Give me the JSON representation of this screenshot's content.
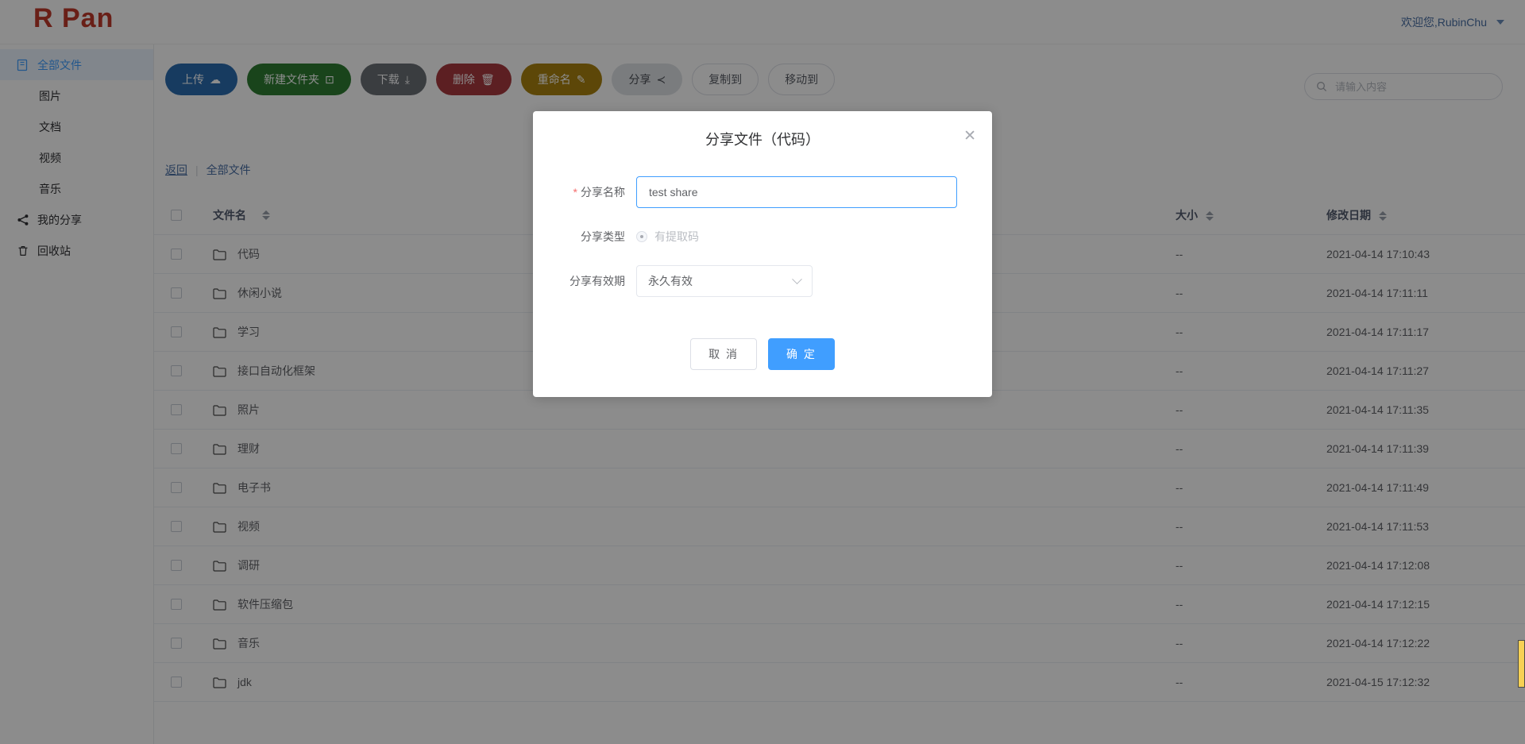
{
  "app": {
    "logo": "R Pan",
    "user_greeting": "欢迎您,RubinChu"
  },
  "sidebar": {
    "items": [
      {
        "label": "全部文件",
        "icon": "files-icon",
        "active": true,
        "indent": false
      },
      {
        "label": "图片",
        "icon": "",
        "active": false,
        "indent": true
      },
      {
        "label": "文档",
        "icon": "",
        "active": false,
        "indent": true
      },
      {
        "label": "视频",
        "icon": "",
        "active": false,
        "indent": true
      },
      {
        "label": "音乐",
        "icon": "",
        "active": false,
        "indent": true
      },
      {
        "label": "我的分享",
        "icon": "share-icon",
        "active": false,
        "indent": false
      },
      {
        "label": "回收站",
        "icon": "trash-icon",
        "active": false,
        "indent": false
      }
    ]
  },
  "toolbar": {
    "buttons": [
      {
        "label": "上传",
        "glyph": "☁",
        "style": "primary"
      },
      {
        "label": "新建文件夹",
        "glyph": "⊡",
        "style": "success"
      },
      {
        "label": "下载",
        "glyph": "⤓",
        "style": "info"
      },
      {
        "label": "删除",
        "glyph": "🗑",
        "style": "danger"
      },
      {
        "label": "重命名",
        "glyph": "✎",
        "style": "warning"
      },
      {
        "label": "分享",
        "glyph": "≺",
        "style": "plain-a"
      },
      {
        "label": "复制到",
        "glyph": "",
        "style": "plain"
      },
      {
        "label": "移动到",
        "glyph": "",
        "style": "plain"
      }
    ]
  },
  "search": {
    "placeholder": "请输入内容",
    "value": ""
  },
  "breadcrumb": {
    "back_label": "返回",
    "separator": "|",
    "current": "全部文件"
  },
  "table": {
    "headers": {
      "name": "文件名",
      "size": "大小",
      "date": "修改日期"
    },
    "rows": [
      {
        "name": "代码",
        "size": "--",
        "date": "2021-04-14 17:10:43"
      },
      {
        "name": "休闲小说",
        "size": "--",
        "date": "2021-04-14 17:11:11"
      },
      {
        "name": "学习",
        "size": "--",
        "date": "2021-04-14 17:11:17"
      },
      {
        "name": "接口自动化框架",
        "size": "--",
        "date": "2021-04-14 17:11:27"
      },
      {
        "name": "照片",
        "size": "--",
        "date": "2021-04-14 17:11:35"
      },
      {
        "name": "理财",
        "size": "--",
        "date": "2021-04-14 17:11:39"
      },
      {
        "name": "电子书",
        "size": "--",
        "date": "2021-04-14 17:11:49"
      },
      {
        "name": "视频",
        "size": "--",
        "date": "2021-04-14 17:11:53"
      },
      {
        "name": "调研",
        "size": "--",
        "date": "2021-04-14 17:12:08"
      },
      {
        "name": "软件压缩包",
        "size": "--",
        "date": "2021-04-14 17:12:15"
      },
      {
        "name": "音乐",
        "size": "--",
        "date": "2021-04-14 17:12:22"
      },
      {
        "name": "jdk",
        "size": "--",
        "date": "2021-04-15 17:12:32"
      }
    ]
  },
  "modal": {
    "title": "分享文件（代码）",
    "close_label": "✕",
    "fields": {
      "name_label": "分享名称",
      "name_value": "test share",
      "name_required_mark": "*",
      "type_label": "分享类型",
      "type_option": "有提取码",
      "expire_label": "分享有效期",
      "expire_value": "永久有效"
    },
    "cancel_label": "取 消",
    "confirm_label": "确 定"
  },
  "colors": {
    "brand_red": "#c0392b",
    "accent_blue": "#409eff",
    "link_blue": "#4a6fa5",
    "upload_blue": "#2b6cb0",
    "new_folder_green": "#2f7d32",
    "download_gray": "#6b6f76",
    "delete_red": "#a83a3f",
    "rename_gold": "#a9820f"
  }
}
